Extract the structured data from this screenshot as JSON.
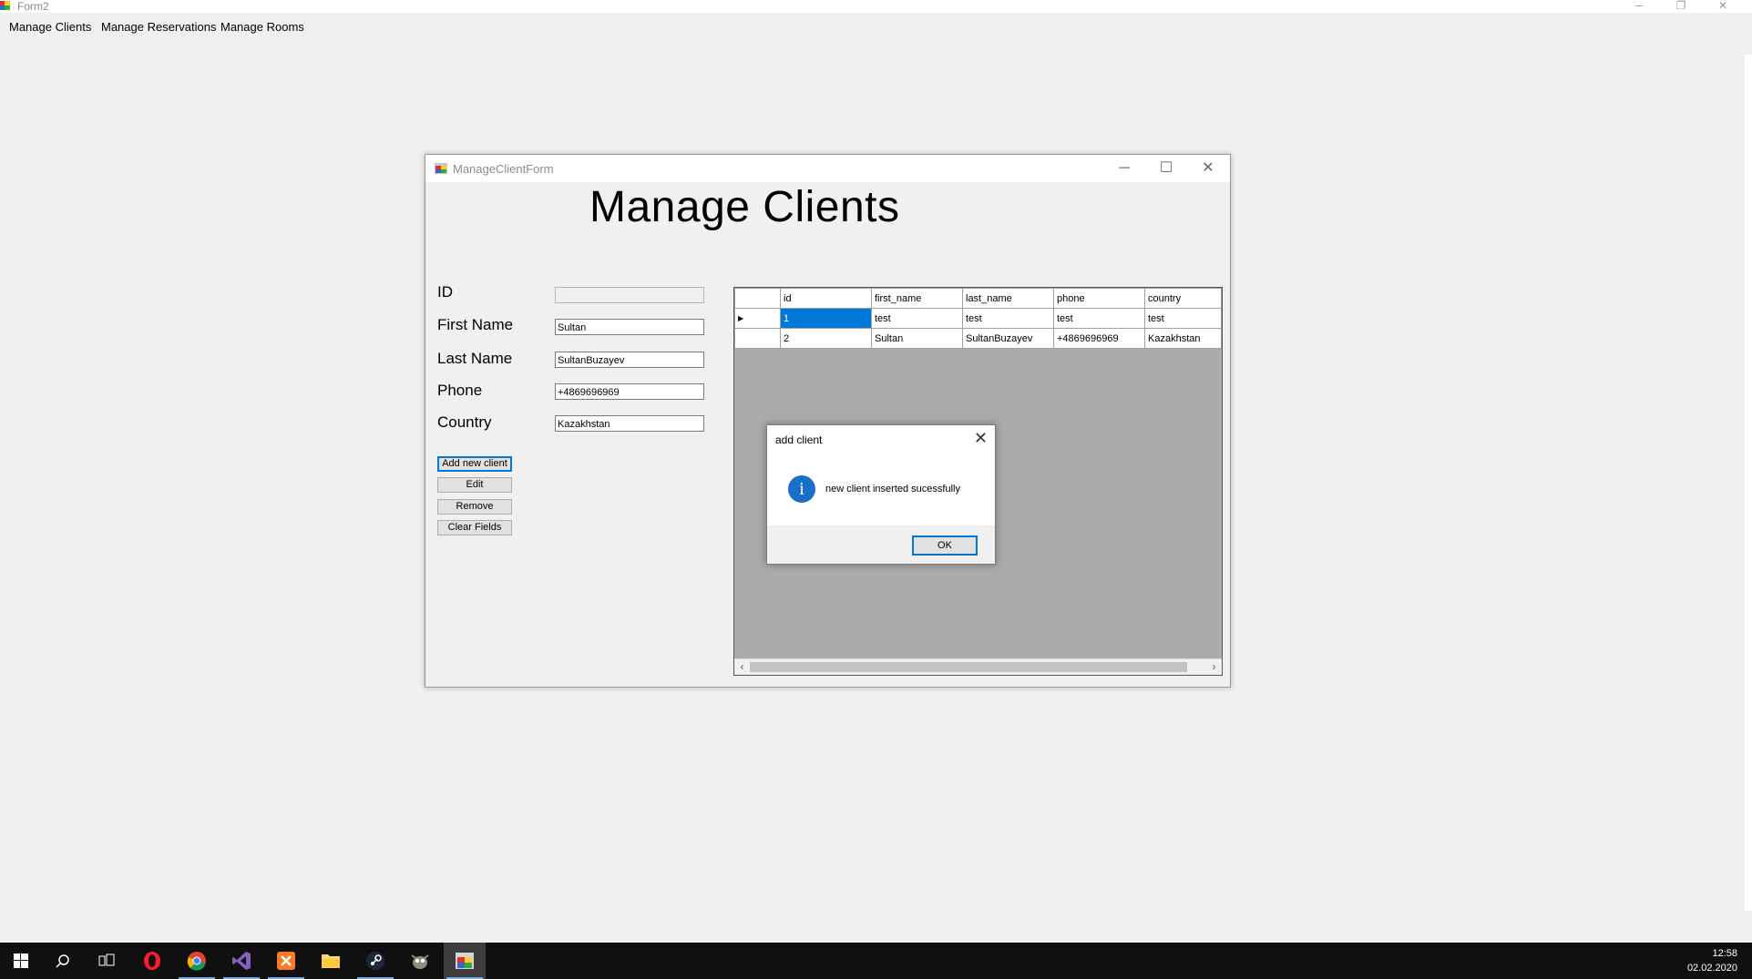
{
  "main_window": {
    "title": "Form2",
    "controls": {
      "minimize": "─",
      "restore": "❐",
      "close": "✕"
    }
  },
  "menu": {
    "items": [
      {
        "label": "Manage Clients"
      },
      {
        "label": "Manage Reservations"
      },
      {
        "label": "Manage Rooms"
      }
    ]
  },
  "child_form": {
    "title": "ManageClientForm",
    "controls": {
      "minimize": "─",
      "maximize": "☐",
      "close": "✕"
    },
    "heading": "Manage Clients",
    "fields": {
      "id": {
        "label": "ID",
        "value": ""
      },
      "first_name": {
        "label": "First Name",
        "value": "Sultan"
      },
      "last_name": {
        "label": "Last Name",
        "value": "SultanBuzayev"
      },
      "phone": {
        "label": "Phone",
        "value": "+4869696969"
      },
      "country": {
        "label": "Country",
        "value": "Kazakhstan"
      }
    },
    "buttons": {
      "add": "Add new client",
      "edit": "Edit",
      "remove": "Remove",
      "clear": "Clear Fields"
    },
    "grid": {
      "columns": [
        "id",
        "first_name",
        "last_name",
        "phone",
        "country"
      ],
      "rows": [
        {
          "id": "1",
          "first_name": "test",
          "last_name": "test",
          "phone": "test",
          "country": "test"
        },
        {
          "id": "2",
          "first_name": "Sultan",
          "last_name": "SultanBuzayev",
          "phone": "+4869696969",
          "country": "Kazakhstan"
        }
      ],
      "current_row_marker": "▶"
    }
  },
  "message_box": {
    "title": "add client",
    "close": "✕",
    "icon": "information-icon",
    "icon_glyph": "i",
    "message": "new client inserted sucessfully",
    "ok": "OK"
  },
  "taskbar": {
    "apps": [
      "windows-start",
      "search",
      "task-view",
      "opera",
      "chrome",
      "visual-studio",
      "xampp",
      "file-explorer",
      "steam",
      "gimp",
      "winforms-app"
    ],
    "time": "12:58",
    "date": "02.02.2020"
  },
  "colors": {
    "selection": "#0078d7",
    "grid_background": "#ababab",
    "taskbar": "#101010",
    "info_icon": "#1b6fc9"
  }
}
